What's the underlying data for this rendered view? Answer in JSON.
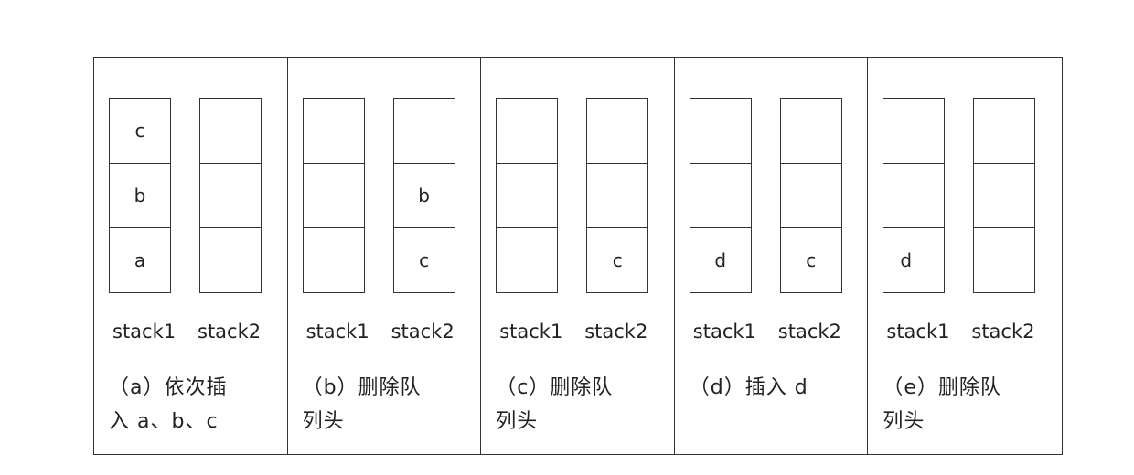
{
  "stack_labels": [
    "stack1",
    "stack2"
  ],
  "panels": [
    {
      "stack1": [
        "c",
        "b",
        "a"
      ],
      "stack2": [
        "",
        "",
        ""
      ],
      "caption_line1": "（a）依次插",
      "caption_line2": "入 a、b、c"
    },
    {
      "stack1": [
        "",
        "",
        ""
      ],
      "stack2": [
        "",
        "b",
        "c"
      ],
      "caption_line1": "（b）删除队",
      "caption_line2": "列头"
    },
    {
      "stack1": [
        "",
        "",
        ""
      ],
      "stack2": [
        "",
        "",
        "c"
      ],
      "caption_line1": "（c）删除队",
      "caption_line2": "列头"
    },
    {
      "stack1": [
        "",
        "",
        "d"
      ],
      "stack2": [
        "",
        "",
        "c"
      ],
      "caption_line1": "（d）插入 d",
      "caption_line2": ""
    },
    {
      "stack1": [
        "",
        "",
        "d"
      ],
      "stack2": [
        "",
        "",
        ""
      ],
      "caption_line1": "（e）删除队",
      "caption_line2": "列头"
    }
  ]
}
